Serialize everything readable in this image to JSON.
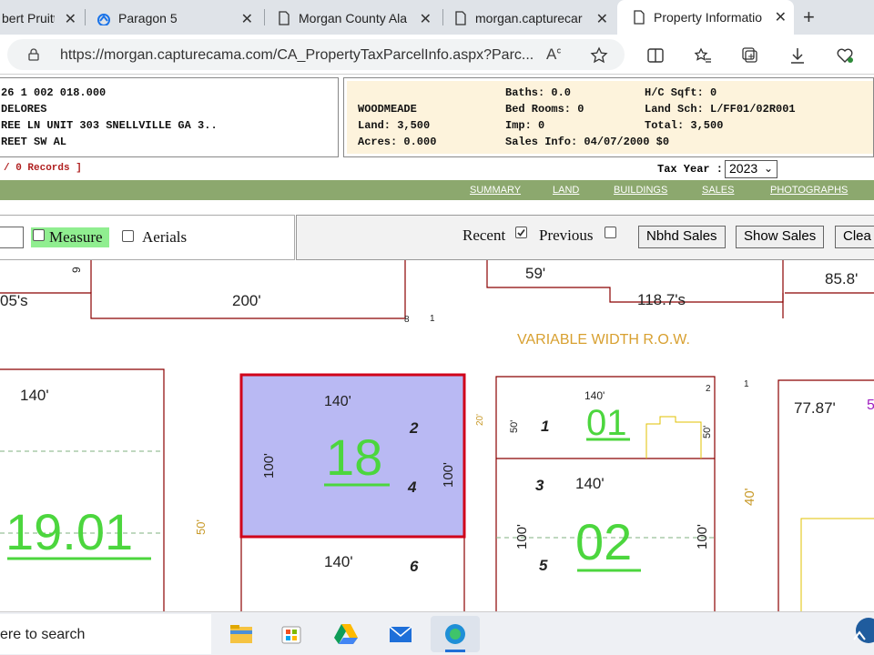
{
  "tabs": [
    {
      "title": "bert Pruitt",
      "icon": "document-icon"
    },
    {
      "title": "Paragon 5",
      "icon": "paragon-icon"
    },
    {
      "title": "Morgan County Ala",
      "icon": "document-icon"
    },
    {
      "title": "morgan.capturecar",
      "icon": "document-icon"
    },
    {
      "title": "Property Informatio",
      "icon": "document-icon",
      "active": true
    }
  ],
  "address_bar": {
    "url": "https://morgan.capturecama.com/CA_PropertyTaxParcelInfo.aspx?Parc..."
  },
  "owner": {
    "parcel_id": "26 1 002 018.000",
    "name": "DELORES",
    "address1": "REE LN UNIT 303 SNELLVILLE GA 3..",
    "address2": "REET SW AL"
  },
  "parcel": {
    "subdivision": "WOODMEADE",
    "land": "Land: 3,500",
    "acres": "Acres: 0.000",
    "baths": "Baths: 0.0",
    "bedrooms": "Bed Rooms: 0",
    "imp": "Imp: 0",
    "sales_info": "Sales Info: 04/07/2000  $0",
    "hc_sqft": "H/C Sqft: 0",
    "land_sch": "Land Sch: L/FF01/02R001",
    "total": "Total: 3,500"
  },
  "records": "/ 0 Records ]",
  "tax_year": {
    "label": "Tax Year :",
    "selected": "2023"
  },
  "menu": [
    "SUMMARY",
    "LAND",
    "BUILDINGS",
    "SALES",
    "PHOTOGRAPHS"
  ],
  "toolbar": {
    "measure_label": "Measure",
    "aerials_label": "Aerials",
    "recent_label": "Recent",
    "recent_checked": true,
    "previous_label": "Previous",
    "previous_checked": false,
    "nbhd_sales": "Nbhd Sales",
    "show_sales": "Show Sales",
    "clear": "Clea"
  },
  "map": {
    "highlight_color": "#b9b9f3",
    "highlight_border": "#d0001a",
    "parcel_line_color": "#8b0000",
    "lot_number_color": "#4cd63e",
    "dim_color": "#c89a2a",
    "lot_numbers": {
      "l18": "18",
      "l1901": "19.01",
      "l01": "01",
      "l02": "02"
    },
    "labels": {
      "t05s": "05's",
      "t200": "200'",
      "t59": "59'",
      "t1187": "118.7's",
      "t858": "85.8'",
      "t9": "9",
      "t8": "8",
      "t1": "1",
      "tvar": "VARIABLE WIDTH R.O.W.",
      "t140a": "140'",
      "t140b": "140'",
      "t140c": "140'",
      "t140d": "140'",
      "t140e": "140'",
      "t100a": "100'",
      "t100b": "100'",
      "t100c": "100'",
      "t100d": "100'",
      "t2": "2",
      "t4": "4",
      "t6": "6",
      "t1r": "1",
      "t3": "3",
      "t5": "5",
      "t2r": "2",
      "t1far": "1",
      "t20": "20'",
      "t50a": "50'",
      "t50b": "50'",
      "t50c": "50'",
      "t40": "40'",
      "t7787": "77.87'",
      "t5f": "5"
    }
  },
  "taskbar": {
    "search_placeholder": "ere to search",
    "apps": [
      "file-explorer-icon",
      "store-icon",
      "google-drive-icon",
      "mail-icon",
      "edge-icon"
    ]
  }
}
